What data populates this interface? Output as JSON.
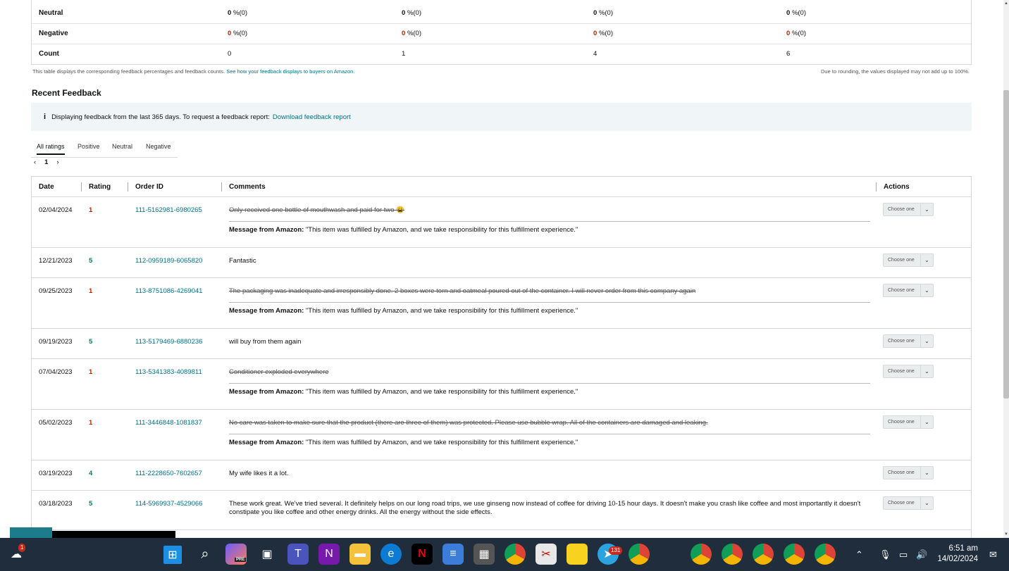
{
  "summary": {
    "rows": [
      {
        "label": "Neutral",
        "values": [
          [
            "0",
            "%(0)"
          ],
          [
            "0",
            "%(0)"
          ],
          [
            "0",
            "%(0)"
          ],
          [
            "0",
            "%(0)"
          ]
        ]
      },
      {
        "label": "Negative",
        "values": [
          [
            "0",
            "%(0)"
          ],
          [
            "0",
            "%(0)"
          ],
          [
            "0",
            "%(0)"
          ],
          [
            "0",
            "%(0)"
          ]
        ]
      },
      {
        "label": "Count",
        "values": [
          "0",
          "1",
          "4",
          "6"
        ]
      }
    ],
    "note_left": "This table displays the corresponding feedback percentages and feedback counts.",
    "note_link": "See how your feedback displays to buyers on Amazon.",
    "note_right": "Due to rounding, the values displayed may not add up to 100%."
  },
  "recent": {
    "title": "Recent Feedback",
    "info_icon": "i",
    "info_text": "Displaying feedback from the last 365 days. To request a feedback report:",
    "info_link": "Download feedback report",
    "tabs": [
      "All ratings",
      "Positive",
      "Neutral",
      "Negative"
    ],
    "pager": {
      "prev": "‹",
      "page": "1",
      "next": "›"
    },
    "headers": {
      "date": "Date",
      "rating": "Rating",
      "order": "Order ID",
      "comments": "Comments",
      "actions": "Actions"
    },
    "select_label": "Choose one",
    "msg_label": "Message from Amazon:",
    "msg_text": "\"This item was fulfilled by Amazon, and we take responsibility for this fulfillment experience.\"",
    "rows": [
      {
        "date": "02/04/2024",
        "rating": "1",
        "order": "111-5162981-6980265",
        "comment": "Only received one bottle of mouthwash and paid for two 😩"
      },
      {
        "date": "12/21/2023",
        "rating": "5",
        "order": "112-0959189-6065820",
        "comment": "Fantastic"
      },
      {
        "date": "09/25/2023",
        "rating": "1",
        "order": "113-8751086-4269041",
        "comment": "The packaging was inadequate and irresponsibly done. 2 boxes were torn and oatmeal poured out of the container. I will never order from this company again"
      },
      {
        "date": "09/19/2023",
        "rating": "5",
        "order": "113-5179469-6880236",
        "comment": "will buy from them again"
      },
      {
        "date": "07/04/2023",
        "rating": "1",
        "order": "113-5341383-4089811",
        "comment": "Conditioner exploded everywhere"
      },
      {
        "date": "05/02/2023",
        "rating": "1",
        "order": "111-3446848-1081837",
        "comment": "No care was taken to make sure that the product (there are three of them) was protected. Please use bubble wrap. All of the containers are damaged and leaking."
      },
      {
        "date": "03/19/2023",
        "rating": "4",
        "order": "111-2228650-7602657",
        "comment": "My wife likes it a lot."
      },
      {
        "date": "03/18/2023",
        "rating": "5",
        "order": "114-5969937-4529066",
        "comment": "These work great. We've tried several. It definitely helps on our long road trips, we use ginseng now instead of coffee for driving 10-15 hour days. It doesn't make you crash like coffee and most importantly it doesn't constipate you like coffee and other energy drinks. All the energy without the side effects."
      }
    ]
  },
  "taskbar": {
    "weather_badge": "1",
    "copilot_label": "PRE",
    "telegram_badge": "131",
    "time": "6:51 am",
    "date": "14/02/2024"
  },
  "colors": {
    "link": "#007185",
    "negative": "#b12704",
    "positive": "#067d62",
    "taskbar": "#1f2d3c"
  }
}
